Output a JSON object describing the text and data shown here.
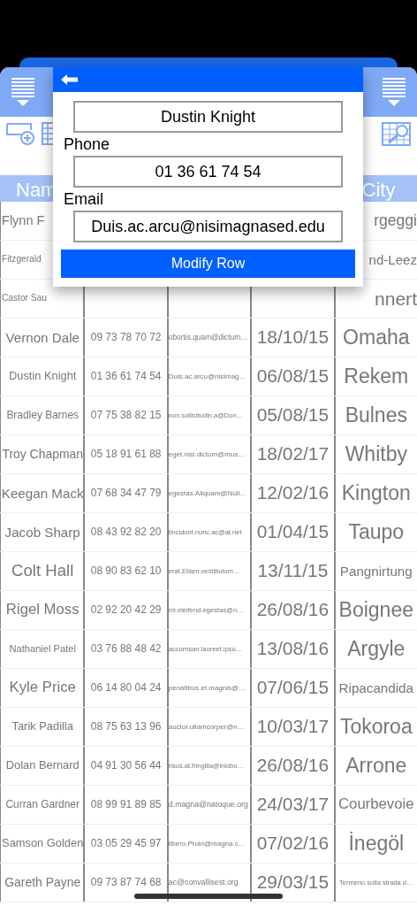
{
  "table": {
    "columns": [
      "Nam",
      "City"
    ],
    "rows": [
      {
        "name": "Flynn F",
        "city": "rgeggi"
      },
      {
        "name": "Fitzgerald",
        "city": "nd-Leez"
      },
      {
        "name": "Castor Sau",
        "city": "nnert"
      },
      {
        "name": "Vernon Dale",
        "phone": "09 73 78 70 72",
        "email": "obortis.quam@dictum…",
        "date": "18/10/15",
        "city": "Omaha"
      },
      {
        "name": "Dustin Knight",
        "phone": "01 36 61 74 54",
        "email": "Duis.ac.arcu@nisimag…",
        "date": "06/08/15",
        "city": "Rekem"
      },
      {
        "name": "Bradley Barnes",
        "phone": "07 75 38 82 15",
        "email": "non.sollicitudin.a@Don…",
        "date": "05/08/15",
        "city": "Bulnes"
      },
      {
        "name": "Troy Chapman",
        "phone": "05 18 91 61 88",
        "email": "eget.nisi.dictum@mus…",
        "date": "18/02/17",
        "city": "Whitby"
      },
      {
        "name": "Keegan Mack",
        "phone": "07 68 34 47 79",
        "email": "egestas.Aliquam@Null…",
        "date": "12/02/16",
        "city": "Kington"
      },
      {
        "name": "Jacob Sharp",
        "phone": "08 43 92 82 20",
        "email": "tincidunt.nunc.ac@at.net",
        "date": "01/04/15",
        "city": "Taupo"
      },
      {
        "name": "Colt Hall",
        "phone": "08 90 83 62 10",
        "email": "erat.Etiam.vestibulum…",
        "date": "13/11/15",
        "city": "Pangnirtung"
      },
      {
        "name": "Rigel Moss",
        "phone": "02 92 20 42 29",
        "email": "mi.eleifend.egestas@n…",
        "date": "26/08/16",
        "city": "Boignee"
      },
      {
        "name": "Nathaniel Patel",
        "phone": "03 76 88 48 42",
        "email": "accumsan.laoreet.ipsu…",
        "date": "13/08/16",
        "city": "Argyle"
      },
      {
        "name": "Kyle Price",
        "phone": "06 14 80 04 24",
        "email": "penatibus.et.magnis@…",
        "date": "07/06/15",
        "city": "Ripacandida"
      },
      {
        "name": "Tarik Padilla",
        "phone": "08 75 63 13 96",
        "email": "auctor.ullamcorper@n…",
        "date": "10/03/17",
        "city": "Tokoroa"
      },
      {
        "name": "Dolan Bernard",
        "phone": "04 91 30 56 44",
        "email": "risus.at.fringilla@inlobo…",
        "date": "26/08/16",
        "city": "Arrone"
      },
      {
        "name": "Curran Gardner",
        "phone": "08 99 91 89 85",
        "email": "d.magna@natoque.org",
        "date": "24/03/17",
        "city": "Courbevoie"
      },
      {
        "name": "Samson Golden",
        "phone": "03 05 29 45 97",
        "email": "libero.Proin@magna.c…",
        "date": "07/02/16",
        "city": "İnegöl"
      },
      {
        "name": "Gareth Payne",
        "phone": "09 73 87 74 68",
        "email": "ac@convallisest.org",
        "date": "29/03/15",
        "city": "Termeno sulla strada d…"
      }
    ]
  },
  "modal": {
    "fields": [
      {
        "value": "Dustin Knight"
      },
      {
        "label": "Phone",
        "value": "01 36 61 74 54"
      },
      {
        "label": "Email",
        "value": "Duis.ac.arcu@nisimagnased.edu"
      }
    ],
    "button": "Modify Row"
  }
}
